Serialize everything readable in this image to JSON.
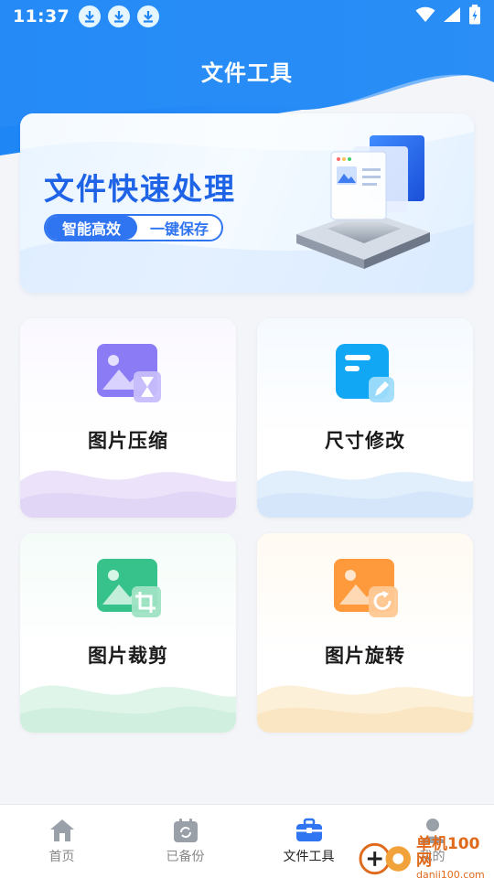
{
  "status_bar": {
    "time": "11:37",
    "download_icons": [
      "download-icon",
      "download-icon",
      "download-icon"
    ]
  },
  "header": {
    "title": "文件工具"
  },
  "banner": {
    "title": "文件快速处理",
    "tag_left": "智能高效",
    "tag_right": "一键保存"
  },
  "tools": [
    {
      "label": "图片压缩",
      "icon": "image-compress-icon",
      "color": "#8b7cf6"
    },
    {
      "label": "尺寸修改",
      "icon": "resize-edit-icon",
      "color": "#12a7f5"
    },
    {
      "label": "图片裁剪",
      "icon": "image-crop-icon",
      "color": "#36c28a"
    },
    {
      "label": "图片旋转",
      "icon": "image-rotate-icon",
      "color": "#ff9a3c"
    }
  ],
  "bottom_nav": {
    "items": [
      {
        "label": "首页",
        "icon": "home-icon"
      },
      {
        "label": "已备份",
        "icon": "backup-icon"
      },
      {
        "label": "文件工具",
        "icon": "toolbox-icon",
        "active": true
      },
      {
        "label": "我的",
        "icon": "user-icon"
      }
    ]
  },
  "watermark": {
    "main": "单机100网",
    "sub": "danji100.com"
  },
  "colors": {
    "primary": "#2f74f0",
    "header_bg": "#1e80f3"
  }
}
